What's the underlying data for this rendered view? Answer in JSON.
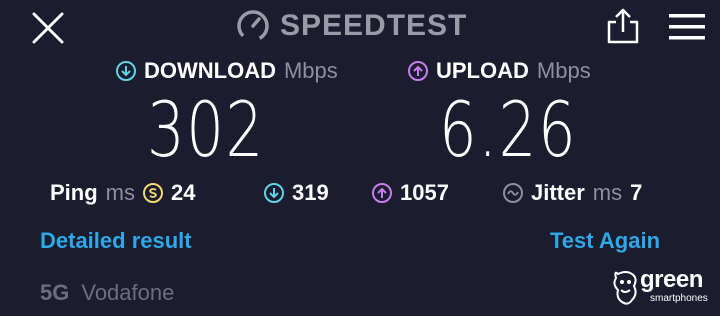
{
  "header": {
    "brand": "SPEEDTEST"
  },
  "download": {
    "label": "DOWNLOAD",
    "unit": "Mbps",
    "value": "302"
  },
  "upload": {
    "label": "UPLOAD",
    "unit": "Mbps",
    "value": "6.26"
  },
  "stats": {
    "ping_label": "Ping",
    "ping_unit": "ms",
    "ping_value": "24",
    "download_ping": "319",
    "upload_ping": "1057",
    "jitter_label": "Jitter",
    "jitter_unit": "ms",
    "jitter_value": "7"
  },
  "actions": {
    "detailed": "Detailed result",
    "again": "Test Again"
  },
  "network": {
    "type": "5G",
    "provider": "Vodafone"
  },
  "watermark": {
    "main": "green",
    "sub": "smartphones"
  },
  "colors": {
    "background": "#1b1c2e",
    "download_accent": "#5fd4e6",
    "upload_accent": "#c77df0",
    "ping_accent": "#f3d873",
    "link": "#2ea8e6"
  }
}
